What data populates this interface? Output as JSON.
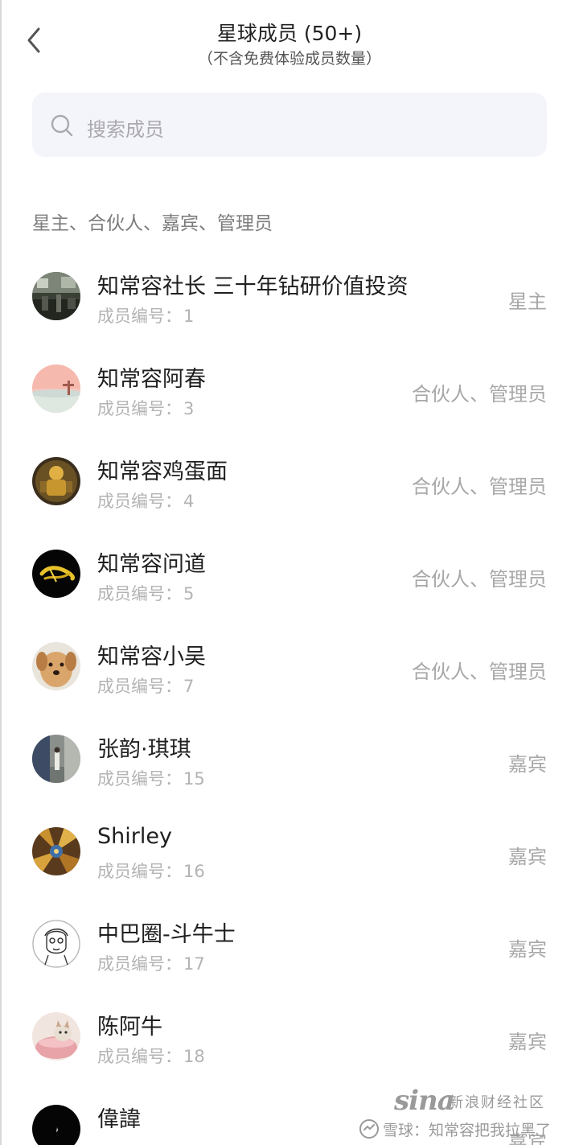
{
  "header": {
    "title": "星球成员 (50+)",
    "subtitle": "（不含免费体验成员数量）"
  },
  "search": {
    "placeholder": "搜索成员"
  },
  "section": {
    "title": "星主、合伙人、嘉宾、管理员"
  },
  "member_no_label": "成员编号：",
  "members": [
    {
      "name": "知常容社长 三十年钻研价值投资",
      "number": "1",
      "role": "星主",
      "avatar": "photo-dark-room"
    },
    {
      "name": "知常容阿春",
      "number": "3",
      "role": "合伙人、管理员",
      "avatar": "pink-sunset-illustration"
    },
    {
      "name": "知常容鸡蛋面",
      "number": "4",
      "role": "合伙人、管理员",
      "avatar": "golden-figure"
    },
    {
      "name": "知常容问道",
      "number": "5",
      "role": "合伙人、管理员",
      "avatar": "gold-calligraphy-on-black"
    },
    {
      "name": "知常容小吴",
      "number": "7",
      "role": "合伙人、管理员",
      "avatar": "dog-face"
    },
    {
      "name": "张韵·琪琪",
      "number": "15",
      "role": "嘉宾",
      "avatar": "street-photo"
    },
    {
      "name": "Shirley",
      "number": "16",
      "role": "嘉宾",
      "avatar": "cathedral-ceiling"
    },
    {
      "name": "中巴圈-斗牛士",
      "number": "17",
      "role": "嘉宾",
      "avatar": "sketch-portrait"
    },
    {
      "name": "陈阿牛",
      "number": "18",
      "role": "嘉宾",
      "avatar": "cat-in-bowl"
    },
    {
      "name": "偉諱",
      "number": "",
      "role": "嘉宾",
      "avatar": "black-circle"
    }
  ],
  "watermark": {
    "logo": "sina",
    "site": "新浪财经社区",
    "text": "雪球：知常容把我拉黑了"
  },
  "colors": {
    "search_bg": "#f4f4fb",
    "role_text": "#a8a8a8",
    "secondary_text": "#b3b3b3"
  }
}
